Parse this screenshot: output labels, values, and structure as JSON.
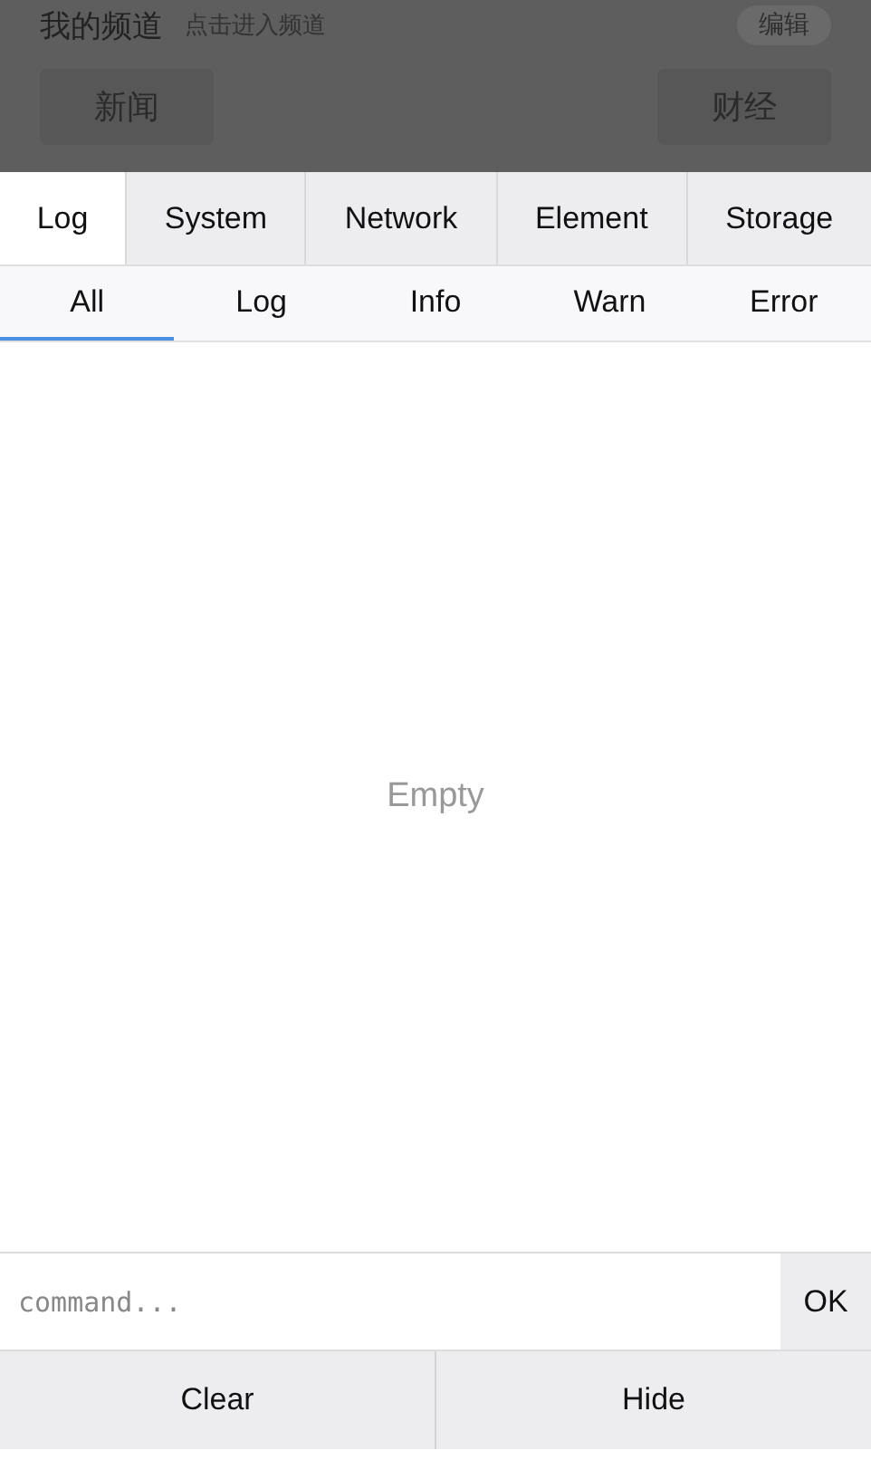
{
  "app_header": {
    "title": "我的频道",
    "hint": "点击进入频道",
    "edit_button": "编辑"
  },
  "channels": [
    {
      "label": "新闻"
    },
    {
      "label": "财经"
    }
  ],
  "tabs": [
    {
      "label": "Log",
      "selected": true
    },
    {
      "label": "System",
      "selected": false
    },
    {
      "label": "Network",
      "selected": false
    },
    {
      "label": "Element",
      "selected": false
    },
    {
      "label": "Storage",
      "selected": false
    }
  ],
  "filters": [
    {
      "label": "All",
      "selected": true
    },
    {
      "label": "Log",
      "selected": false
    },
    {
      "label": "Info",
      "selected": false
    },
    {
      "label": "Warn",
      "selected": false
    },
    {
      "label": "Error",
      "selected": false
    }
  ],
  "log_panel": {
    "empty_text": "Empty"
  },
  "command": {
    "placeholder": "command...",
    "submit": "OK"
  },
  "footer_buttons": [
    "Clear",
    "Hide"
  ]
}
